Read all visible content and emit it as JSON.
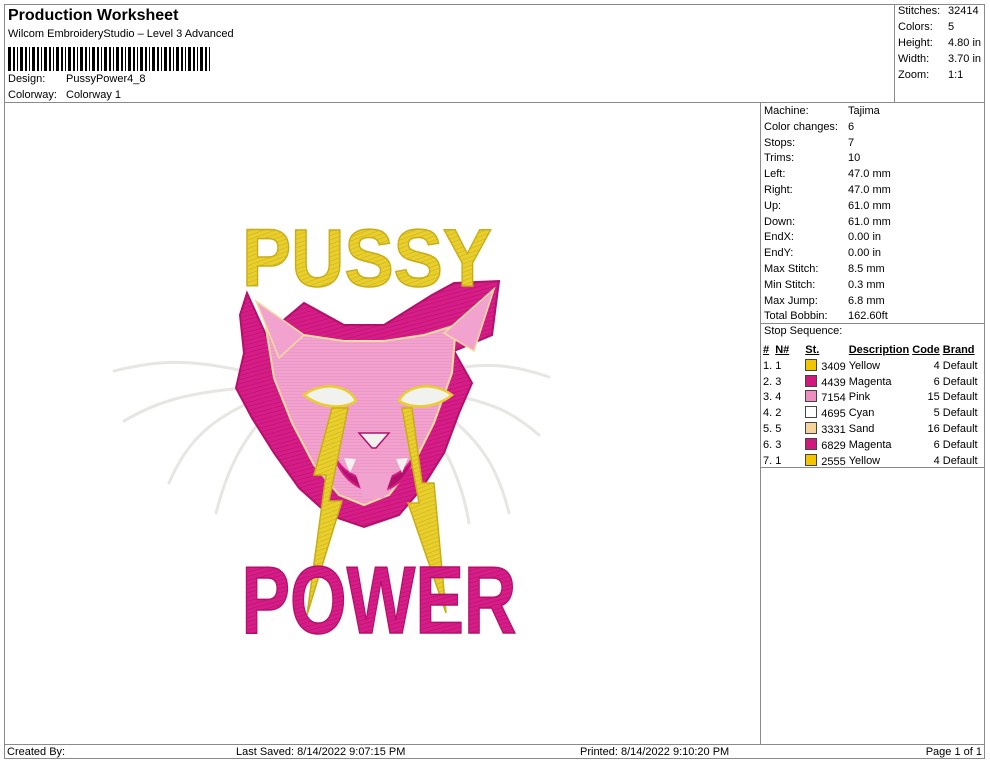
{
  "header": {
    "title": "Production Worksheet",
    "subtitle": "Wilcom EmbroideryStudio – Level 3 Advanced",
    "design_label": "Design:",
    "design_value": "PussyPower4_8",
    "colorway_label": "Colorway:",
    "colorway_value": "Colorway 1"
  },
  "stats": [
    {
      "label": "Stitches:",
      "value": "32414"
    },
    {
      "label": "Colors:",
      "value": "5"
    },
    {
      "label": "Height:",
      "value": "4.80 in"
    },
    {
      "label": "Width:",
      "value": "3.70 in"
    },
    {
      "label": "Zoom:",
      "value": "1:1"
    }
  ],
  "machine_info": [
    {
      "label": "Machine:",
      "value": "Tajima"
    },
    {
      "label": "Color changes:",
      "value": "6"
    },
    {
      "label": "Stops:",
      "value": "7"
    },
    {
      "label": "Trims:",
      "value": "10"
    },
    {
      "label": "Left:",
      "value": "47.0 mm"
    },
    {
      "label": "Right:",
      "value": "47.0 mm"
    },
    {
      "label": "Up:",
      "value": "61.0 mm"
    },
    {
      "label": "Down:",
      "value": "61.0 mm"
    },
    {
      "label": "EndX:",
      "value": "0.00 in"
    },
    {
      "label": "EndY:",
      "value": "0.00 in"
    },
    {
      "label": "Max Stitch:",
      "value": "8.5 mm"
    },
    {
      "label": "Min Stitch:",
      "value": "0.3 mm"
    },
    {
      "label": "Max Jump:",
      "value": "6.8 mm"
    },
    {
      "label": "Total Bobbin:",
      "value": "162.60ft"
    }
  ],
  "stop_sequence": {
    "title": "Stop Sequence:",
    "headers": [
      "#",
      "N#",
      "St.",
      "Description",
      "Code",
      "Brand"
    ],
    "rows": [
      {
        "num": "1.",
        "n": "1",
        "color": "#f2c500",
        "st": "3409",
        "desc": "Yellow",
        "code": "4",
        "brand": "Default"
      },
      {
        "num": "2.",
        "n": "3",
        "color": "#d0197c",
        "st": "4439",
        "desc": "Magenta",
        "code": "6",
        "brand": "Default"
      },
      {
        "num": "3.",
        "n": "4",
        "color": "#ee8ec0",
        "st": "7154",
        "desc": "Pink",
        "code": "15",
        "brand": "Default"
      },
      {
        "num": "4.",
        "n": "2",
        "color": "#ffffff",
        "st": "4695",
        "desc": "Cyan",
        "code": "5",
        "brand": "Default"
      },
      {
        "num": "5.",
        "n": "5",
        "color": "#f6d39a",
        "st": "3331",
        "desc": "Sand",
        "code": "16",
        "brand": "Default"
      },
      {
        "num": "6.",
        "n": "3",
        "color": "#d0197c",
        "st": "6829",
        "desc": "Magenta",
        "code": "6",
        "brand": "Default"
      },
      {
        "num": "7.",
        "n": "1",
        "color": "#f2c500",
        "st": "2555",
        "desc": "Yellow",
        "code": "4",
        "brand": "Default"
      }
    ]
  },
  "design_preview": {
    "top_text": "PUSSY",
    "bottom_text": "POWER",
    "colors": {
      "yellow": "#e8cf2e",
      "magenta": "#d61c86",
      "pink": "#f2a2cf",
      "white": "#f1f1ee",
      "sand": "#f2dca0"
    }
  },
  "footer": {
    "created_by": "Created By:",
    "last_saved": "Last Saved: 8/14/2022 9:07:15 PM",
    "printed": "Printed: 8/14/2022 9:10:20 PM",
    "page": "Page 1 of 1"
  }
}
